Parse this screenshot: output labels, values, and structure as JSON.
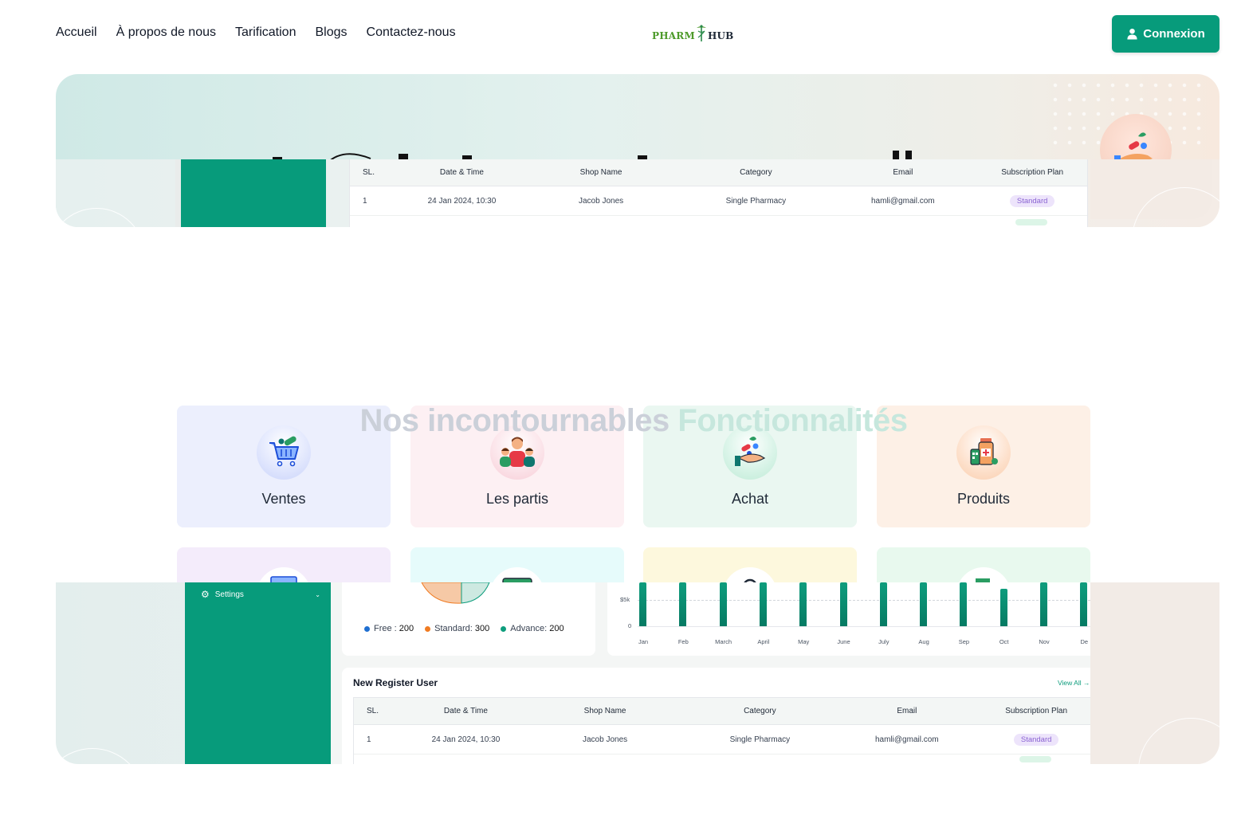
{
  "nav": {
    "links": [
      "Accueil",
      "À propos de nous",
      "Tarification",
      "Blogs",
      "Contactez-nous"
    ],
    "logo": {
      "part1": "PHARM",
      "part2": "HUB"
    },
    "login_label": "Connexion"
  },
  "dashboard_top": {
    "table_headers": [
      "SL.",
      "Date & Time",
      "Shop Name",
      "Category",
      "Email",
      "Subscription Plan"
    ],
    "rows": [
      {
        "sl": "1",
        "date": "24 Jan 2024, 10:30",
        "shop": "Jacob Jones",
        "category": "Single Pharmacy",
        "email": "hamli@gmail.com",
        "plan": "Standard"
      }
    ]
  },
  "features": {
    "title_part1": "Nos incontournables",
    "title_part2": "Fonctionnalités",
    "cards": [
      {
        "label": "Ventes",
        "icon": "cart-pills-icon",
        "bg": "#eceffd"
      },
      {
        "label": "Les partis",
        "icon": "people-group-icon",
        "bg": "#fdf0f3"
      },
      {
        "label": "Achat",
        "icon": "hand-pills-icon",
        "bg": "#eaf7f1"
      },
      {
        "label": "Produits",
        "icon": "medicine-products-icon",
        "bg": "#fdf0e6"
      }
    ],
    "row2_bgs": [
      "#f4ecfb",
      "#e6fbfb",
      "#fdf8dd",
      "#e8f9ee"
    ]
  },
  "dashboard_bottom": {
    "settings_label": "Settings",
    "legend": [
      {
        "label": "Free : ",
        "value": "200",
        "color": "#1f6fd1"
      },
      {
        "label": "Standard: ",
        "value": "300",
        "color": "#f07b22"
      },
      {
        "label": "Advance: ",
        "value": "200",
        "color": "#0e9d7d"
      }
    ],
    "chart_data": {
      "type": "bar",
      "categories": [
        "Jan",
        "Feb",
        "March",
        "April",
        "May",
        "June",
        "July",
        "Aug",
        "Sep",
        "Oct",
        "Nov",
        "De"
      ],
      "y_ticks": [
        "$5k",
        "0"
      ]
    },
    "register": {
      "title": "New Register User",
      "view_all": "View All →",
      "table_headers": [
        "SL.",
        "Date & Time",
        "Shop Name",
        "Category",
        "Email",
        "Subscription Plan"
      ],
      "rows": [
        {
          "sl": "1",
          "date": "24 Jan 2024, 10:30",
          "shop": "Jacob Jones",
          "category": "Single Pharmacy",
          "email": "hamli@gmail.com",
          "plan": "Standard"
        }
      ]
    }
  }
}
